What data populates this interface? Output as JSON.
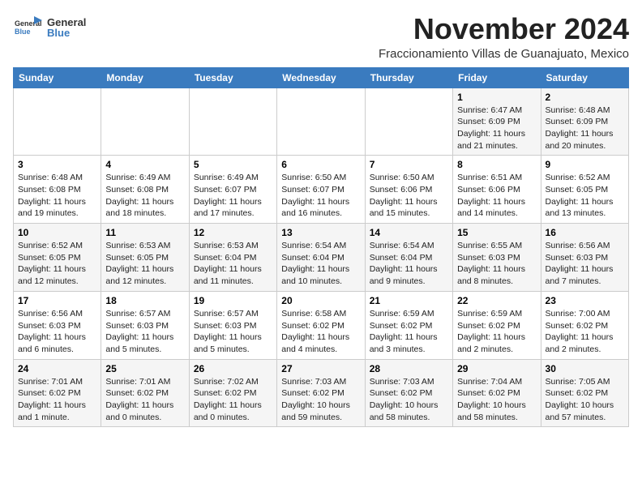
{
  "header": {
    "logo_general": "General",
    "logo_blue": "Blue",
    "month_title": "November 2024",
    "location": "Fraccionamiento Villas de Guanajuato, Mexico"
  },
  "days_of_week": [
    "Sunday",
    "Monday",
    "Tuesday",
    "Wednesday",
    "Thursday",
    "Friday",
    "Saturday"
  ],
  "weeks": [
    [
      {
        "day": "",
        "info": ""
      },
      {
        "day": "",
        "info": ""
      },
      {
        "day": "",
        "info": ""
      },
      {
        "day": "",
        "info": ""
      },
      {
        "day": "",
        "info": ""
      },
      {
        "day": "1",
        "info": "Sunrise: 6:47 AM\nSunset: 6:09 PM\nDaylight: 11 hours and 21 minutes."
      },
      {
        "day": "2",
        "info": "Sunrise: 6:48 AM\nSunset: 6:09 PM\nDaylight: 11 hours and 20 minutes."
      }
    ],
    [
      {
        "day": "3",
        "info": "Sunrise: 6:48 AM\nSunset: 6:08 PM\nDaylight: 11 hours and 19 minutes."
      },
      {
        "day": "4",
        "info": "Sunrise: 6:49 AM\nSunset: 6:08 PM\nDaylight: 11 hours and 18 minutes."
      },
      {
        "day": "5",
        "info": "Sunrise: 6:49 AM\nSunset: 6:07 PM\nDaylight: 11 hours and 17 minutes."
      },
      {
        "day": "6",
        "info": "Sunrise: 6:50 AM\nSunset: 6:07 PM\nDaylight: 11 hours and 16 minutes."
      },
      {
        "day": "7",
        "info": "Sunrise: 6:50 AM\nSunset: 6:06 PM\nDaylight: 11 hours and 15 minutes."
      },
      {
        "day": "8",
        "info": "Sunrise: 6:51 AM\nSunset: 6:06 PM\nDaylight: 11 hours and 14 minutes."
      },
      {
        "day": "9",
        "info": "Sunrise: 6:52 AM\nSunset: 6:05 PM\nDaylight: 11 hours and 13 minutes."
      }
    ],
    [
      {
        "day": "10",
        "info": "Sunrise: 6:52 AM\nSunset: 6:05 PM\nDaylight: 11 hours and 12 minutes."
      },
      {
        "day": "11",
        "info": "Sunrise: 6:53 AM\nSunset: 6:05 PM\nDaylight: 11 hours and 12 minutes."
      },
      {
        "day": "12",
        "info": "Sunrise: 6:53 AM\nSunset: 6:04 PM\nDaylight: 11 hours and 11 minutes."
      },
      {
        "day": "13",
        "info": "Sunrise: 6:54 AM\nSunset: 6:04 PM\nDaylight: 11 hours and 10 minutes."
      },
      {
        "day": "14",
        "info": "Sunrise: 6:54 AM\nSunset: 6:04 PM\nDaylight: 11 hours and 9 minutes."
      },
      {
        "day": "15",
        "info": "Sunrise: 6:55 AM\nSunset: 6:03 PM\nDaylight: 11 hours and 8 minutes."
      },
      {
        "day": "16",
        "info": "Sunrise: 6:56 AM\nSunset: 6:03 PM\nDaylight: 11 hours and 7 minutes."
      }
    ],
    [
      {
        "day": "17",
        "info": "Sunrise: 6:56 AM\nSunset: 6:03 PM\nDaylight: 11 hours and 6 minutes."
      },
      {
        "day": "18",
        "info": "Sunrise: 6:57 AM\nSunset: 6:03 PM\nDaylight: 11 hours and 5 minutes."
      },
      {
        "day": "19",
        "info": "Sunrise: 6:57 AM\nSunset: 6:03 PM\nDaylight: 11 hours and 5 minutes."
      },
      {
        "day": "20",
        "info": "Sunrise: 6:58 AM\nSunset: 6:02 PM\nDaylight: 11 hours and 4 minutes."
      },
      {
        "day": "21",
        "info": "Sunrise: 6:59 AM\nSunset: 6:02 PM\nDaylight: 11 hours and 3 minutes."
      },
      {
        "day": "22",
        "info": "Sunrise: 6:59 AM\nSunset: 6:02 PM\nDaylight: 11 hours and 2 minutes."
      },
      {
        "day": "23",
        "info": "Sunrise: 7:00 AM\nSunset: 6:02 PM\nDaylight: 11 hours and 2 minutes."
      }
    ],
    [
      {
        "day": "24",
        "info": "Sunrise: 7:01 AM\nSunset: 6:02 PM\nDaylight: 11 hours and 1 minute."
      },
      {
        "day": "25",
        "info": "Sunrise: 7:01 AM\nSunset: 6:02 PM\nDaylight: 11 hours and 0 minutes."
      },
      {
        "day": "26",
        "info": "Sunrise: 7:02 AM\nSunset: 6:02 PM\nDaylight: 11 hours and 0 minutes."
      },
      {
        "day": "27",
        "info": "Sunrise: 7:03 AM\nSunset: 6:02 PM\nDaylight: 10 hours and 59 minutes."
      },
      {
        "day": "28",
        "info": "Sunrise: 7:03 AM\nSunset: 6:02 PM\nDaylight: 10 hours and 58 minutes."
      },
      {
        "day": "29",
        "info": "Sunrise: 7:04 AM\nSunset: 6:02 PM\nDaylight: 10 hours and 58 minutes."
      },
      {
        "day": "30",
        "info": "Sunrise: 7:05 AM\nSunset: 6:02 PM\nDaylight: 10 hours and 57 minutes."
      }
    ]
  ]
}
